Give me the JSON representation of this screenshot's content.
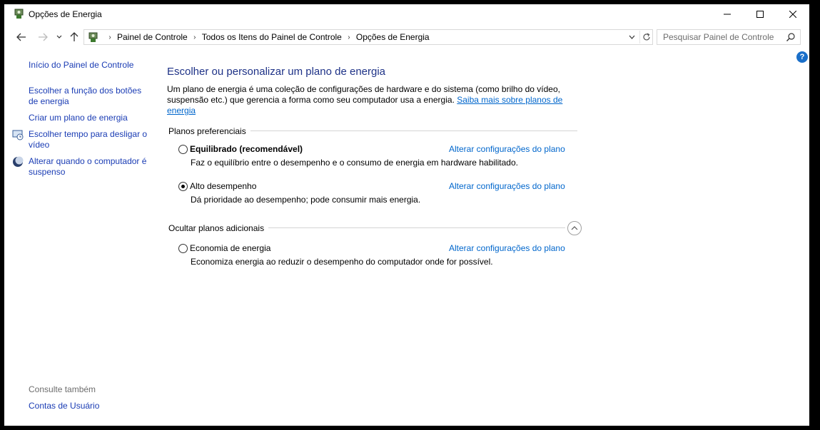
{
  "window": {
    "title": "Opções de Energia"
  },
  "address": {
    "crumbs": [
      "Painel de Controle",
      "Todos os Itens do Painel de Controle",
      "Opções de Energia"
    ]
  },
  "search": {
    "placeholder": "Pesquisar Painel de Controle"
  },
  "help": {
    "label": "?"
  },
  "sidebar": {
    "items": [
      {
        "label": "Início do Painel de Controle"
      },
      {
        "label": "Escolher a função dos botões de energia"
      },
      {
        "label": "Criar um plano de energia"
      },
      {
        "label": "Escolher tempo para desligar o vídeo"
      },
      {
        "label": "Alterar quando o computador é suspenso"
      }
    ],
    "see_also_heading": "Consulte também",
    "see_also_link": "Contas de Usuário"
  },
  "main": {
    "title": "Escolher ou personalizar um plano de energia",
    "intro_text": "Um plano de energia é uma coleção de configurações de hardware e do sistema (como brilho do vídeo, suspensão etc.) que gerencia a forma como seu computador usa a energia. ",
    "intro_link": "Saiba mais sobre planos de energia",
    "preferred_heading": "Planos preferenciais",
    "additional_heading": "Ocultar planos adicionais",
    "plans": [
      {
        "name": "Equilibrado (recomendável)",
        "description": "Faz o equilíbrio entre o desempenho e o consumo de energia em hardware habilitado.",
        "link": "Alterar configurações do plano",
        "selected": false
      },
      {
        "name": "Alto desempenho",
        "description": "Dá prioridade ao desempenho; pode consumir mais energia.",
        "link": "Alterar configurações do plano",
        "selected": true
      },
      {
        "name": "Economia de energia",
        "description": "Economiza energia ao reduzir o desempenho do computador onde for possível.",
        "link": "Alterar configurações do plano",
        "selected": false
      }
    ]
  },
  "colors": {
    "link": "#1a3cb4",
    "title": "#1e3287",
    "help": "#1a6fc9"
  }
}
